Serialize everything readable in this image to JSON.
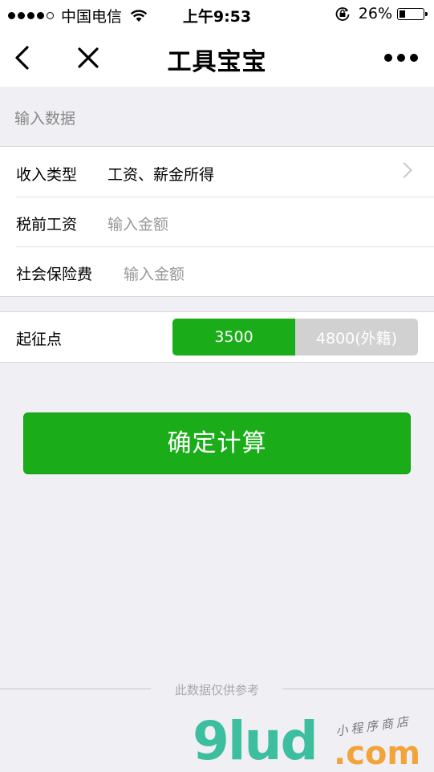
{
  "status_bar": {
    "carrier": "中国电信",
    "time": "上午9:53",
    "battery": "26%",
    "battery_level": 0.26
  },
  "nav": {
    "title": "工具宝宝"
  },
  "section": {
    "header": "输入数据"
  },
  "form": {
    "rows": [
      {
        "label": "收入类型",
        "value": "工资、薪金所得",
        "is_placeholder": false
      },
      {
        "label": "税前工资",
        "value": "输入金额",
        "is_placeholder": true
      },
      {
        "label": "社会保险费",
        "value": "输入金额",
        "is_placeholder": true
      }
    ]
  },
  "threshold": {
    "label": "起征点",
    "options": [
      "3500",
      "4800(外籍)"
    ],
    "selected": "3500"
  },
  "actions": {
    "calculate": "确定计算"
  },
  "footer": {
    "note": "此数据仅供参考"
  },
  "watermark": {
    "brand": "9lud",
    "tld": ".com",
    "tagline": "小程序商店"
  },
  "colors": {
    "primary_green": "#1aad19",
    "background": "#efeff4",
    "inactive_segment": "#d1d1d1"
  }
}
